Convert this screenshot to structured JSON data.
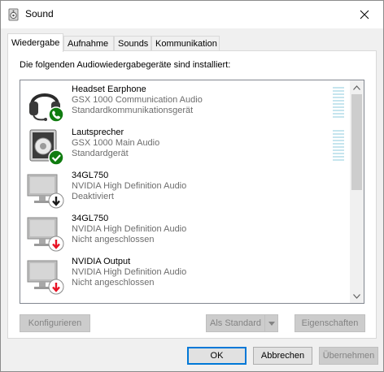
{
  "window": {
    "title": "Sound"
  },
  "tabs": [
    {
      "label": "Wiedergabe",
      "active": true
    },
    {
      "label": "Aufnahme",
      "active": false
    },
    {
      "label": "Sounds",
      "active": false
    },
    {
      "label": "Kommunikation",
      "active": false
    }
  ],
  "intro": "Die folgenden Audiowiedergabegeräte sind installiert:",
  "devices": [
    {
      "name": "Headset Earphone",
      "description": "GSX 1000 Communication Audio",
      "status": "Standardkommunikationsgerät",
      "icon": "headset-icon",
      "badge": "phone-badge-icon",
      "has_meter": true
    },
    {
      "name": "Lautsprecher",
      "description": "GSX 1000 Main Audio",
      "status": "Standardgerät",
      "icon": "speaker-icon",
      "badge": "checkmark-badge-icon",
      "has_meter": true
    },
    {
      "name": "34GL750",
      "description": "NVIDIA High Definition Audio",
      "status": "Deaktiviert",
      "icon": "monitor-icon",
      "badge": "disabled-badge-icon",
      "has_meter": false
    },
    {
      "name": "34GL750",
      "description": "NVIDIA High Definition Audio",
      "status": "Nicht angeschlossen",
      "icon": "monitor-icon",
      "badge": "unplugged-badge-icon",
      "has_meter": false
    },
    {
      "name": "NVIDIA Output",
      "description": "NVIDIA High Definition Audio",
      "status": "Nicht angeschlossen",
      "icon": "monitor-icon",
      "badge": "unplugged-badge-icon",
      "has_meter": false
    }
  ],
  "buttons": {
    "configure": "Konfigurieren",
    "set_default": "Als Standard",
    "properties": "Eigenschaften",
    "ok": "OK",
    "cancel": "Abbrechen",
    "apply": "Übernehmen"
  },
  "colors": {
    "accent": "#0078d7",
    "badge_green": "#107c10",
    "badge_red": "#e81123"
  }
}
